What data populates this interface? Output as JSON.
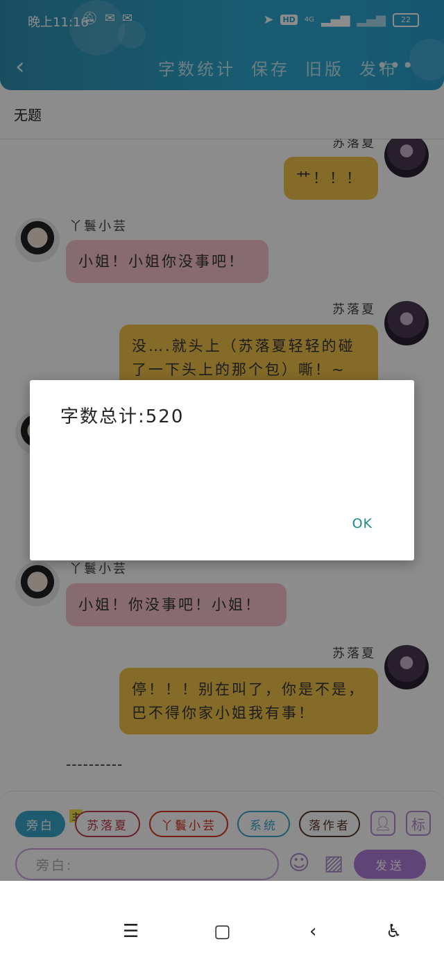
{
  "status_bar": {
    "time": "晚上11:16",
    "battery": "22",
    "network": "4G",
    "hd": "HD"
  },
  "toolbar": {
    "back_label": "‹",
    "word_count": "字数统计",
    "save": "保存",
    "old_version": "旧版",
    "publish": "发布",
    "more": "•••"
  },
  "document": {
    "title": "无题"
  },
  "messages": [
    {
      "name": "苏落夏",
      "text": "艹！！！"
    },
    {
      "name": "丫鬟小芸",
      "text": "小姐！小姐你没事吧！"
    },
    {
      "name": "苏落夏",
      "text": "没….就头上（苏落夏轻轻的碰了一下头上的那个包）嘶！~"
    },
    {
      "name": "丫鬟小芸",
      "text": "小姐！你没事吧！小姐！"
    },
    {
      "name": "苏落夏",
      "text": "停！！！别在叫了，你是不是，巴不得你家小姐我有事！"
    }
  ],
  "separator": "----------",
  "roles": {
    "narration": "旁白",
    "main_tag": "主",
    "su": "苏落夏",
    "xiaoyun": "丫鬟小芸",
    "system": "系统",
    "author": "落作者"
  },
  "input": {
    "placeholder": "旁白:",
    "send": "发送",
    "label_button": "标"
  },
  "dialog": {
    "message": "字数总计:520",
    "ok": "OK"
  },
  "colors": {
    "header": "#2ea1c9",
    "pink_bubble": "#f7c4cc",
    "yellow_bubble": "#f2c44a",
    "send": "#b07ad9"
  }
}
